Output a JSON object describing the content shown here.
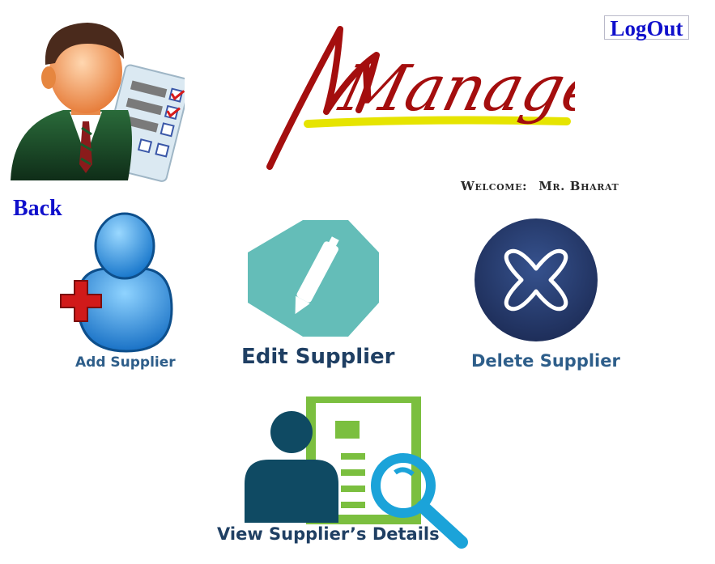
{
  "header": {
    "logo_text": "Manager",
    "logout_label": "LogOut",
    "welcome_label": "Welcome:",
    "user_name": "Mr. Bharat"
  },
  "nav": {
    "back_label": "Back"
  },
  "tiles": [
    {
      "label": "Add Supplier",
      "icon": "add-user-icon"
    },
    {
      "label": "Edit Supplier",
      "icon": "edit-pen-icon"
    },
    {
      "label": "Delete Supplier",
      "icon": "delete-x-icon"
    },
    {
      "label": "View Supplier’s Details",
      "icon": "view-details-icon"
    }
  ],
  "colors": {
    "link_blue": "#1010cc",
    "logo_red": "#a40e0e",
    "logo_yellow": "#e6e400",
    "edit_teal": "#64bdb8",
    "delete_navy": "#2b3f72",
    "view_green": "#7bbf3f",
    "view_blue": "#1ba3d9",
    "view_dark": "#0f4a63"
  }
}
